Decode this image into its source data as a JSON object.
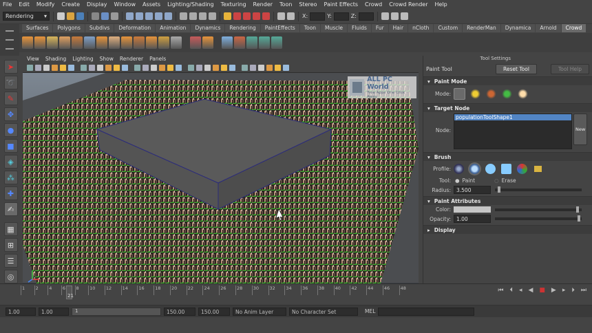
{
  "menubar": [
    "File",
    "Edit",
    "Modify",
    "Create",
    "Display",
    "Window",
    "Assets",
    "Lighting/Shading",
    "Texturing",
    "Render",
    "Toon",
    "Stereo",
    "Paint Effects",
    "Crowd",
    "Crowd Render",
    "Help"
  ],
  "status": {
    "menuset": "Rendering",
    "coord_labels": [
      "X:",
      "Y:",
      "Z:"
    ]
  },
  "shelf_tabs": [
    "Surfaces",
    "Polygons",
    "Subdivs",
    "Deformation",
    "Animation",
    "Dynamics",
    "Rendering",
    "PaintEffects",
    "Toon",
    "Muscle",
    "Fluids",
    "Fur",
    "Hair",
    "nCloth",
    "Custom",
    "RenderMan",
    "Dynamica",
    "Arnold",
    "Crowd"
  ],
  "active_shelf_tab": "Crowd",
  "viewport_menu": [
    "View",
    "Shading",
    "Lighting",
    "Show",
    "Renderer",
    "Panels"
  ],
  "watermark": {
    "title": "ALL PC World",
    "subtitle": "Free Apps One Click Away"
  },
  "tool_settings": {
    "title": "Tool Settings",
    "tool_name": "Paint Tool",
    "reset": "Reset Tool",
    "help": "Tool Help",
    "sec_paint_mode": "Paint Mode",
    "mode_label": "Mode:",
    "sec_target": "Target Node",
    "node_label": "Node:",
    "node_value": "populationToolShape1",
    "new_label": "New",
    "sec_brush": "Brush",
    "profile_label": "Profile:",
    "tool_label": "Tool:",
    "paint_opt": "Paint",
    "erase_opt": "Erase",
    "radius_label": "Radius:",
    "radius_value": "3.500",
    "sec_attrs": "Paint Attributes",
    "color_label": "Color:",
    "opacity_label": "Opacity:",
    "opacity_value": "1.00",
    "sec_display": "Display"
  },
  "timeline": {
    "ticks": [
      "1",
      "2",
      "4",
      "6",
      "8",
      "10",
      "12",
      "14",
      "16",
      "18",
      "20",
      "22",
      "24",
      "26",
      "28",
      "30",
      "32",
      "34",
      "36",
      "38",
      "40",
      "42",
      "44",
      "46",
      "48"
    ],
    "current": "21"
  },
  "range": {
    "start": "1.00",
    "startb": "1.00",
    "min": "1",
    "end": "150.00",
    "endb": "150.00",
    "anim_layer": "No Anim Layer",
    "char_set": "No Character Set",
    "mel": "MEL"
  }
}
